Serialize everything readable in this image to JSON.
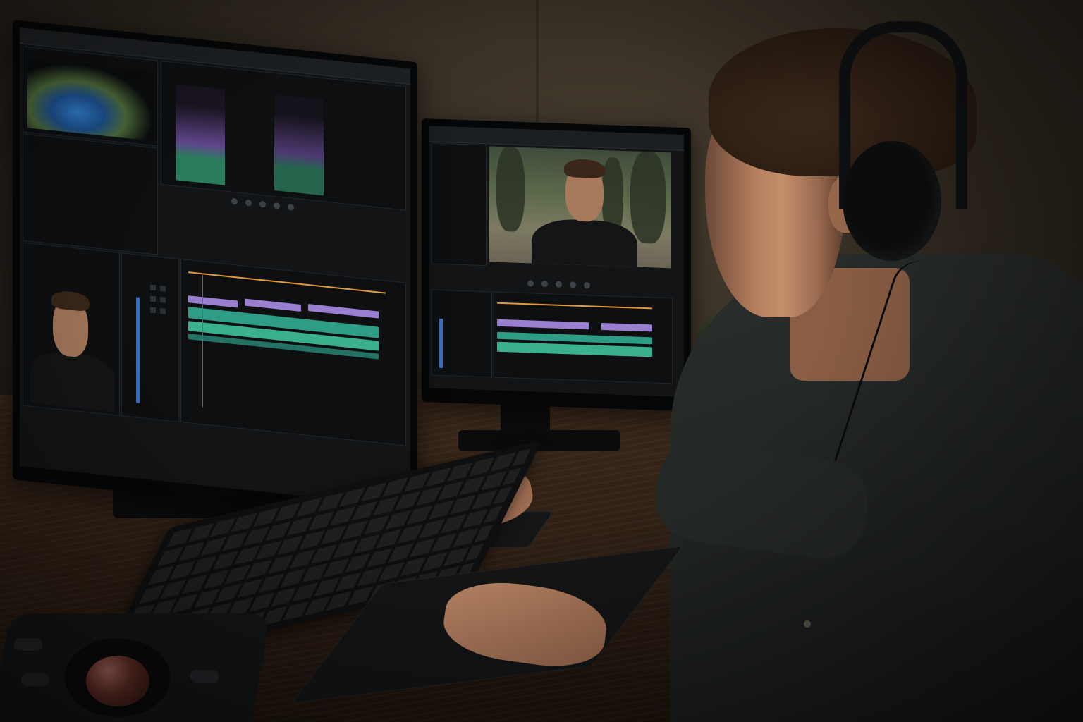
{
  "scene": {
    "description_tags": [
      "video-editor",
      "dual-monitor",
      "headphones",
      "trackball",
      "keyboard"
    ],
    "palette": {
      "wall": "#2f281f",
      "desk": "#2b1d13",
      "screen_bg": "#121416",
      "audio_purple": "#9a7fd1",
      "audio_teal": "#2f9c86",
      "playhead": "#e39b3c",
      "ui_blue": "#2d6fd1"
    }
  },
  "left_monitor": {
    "titlebar_text": "",
    "panels": [
      "scope-panel",
      "audio-waveform-panel",
      "effects-panel",
      "source-preview-panel",
      "timeline-panel"
    ]
  },
  "right_monitor": {
    "titlebar_text": "",
    "panels": [
      "program-monitor",
      "timeline-panel"
    ]
  }
}
